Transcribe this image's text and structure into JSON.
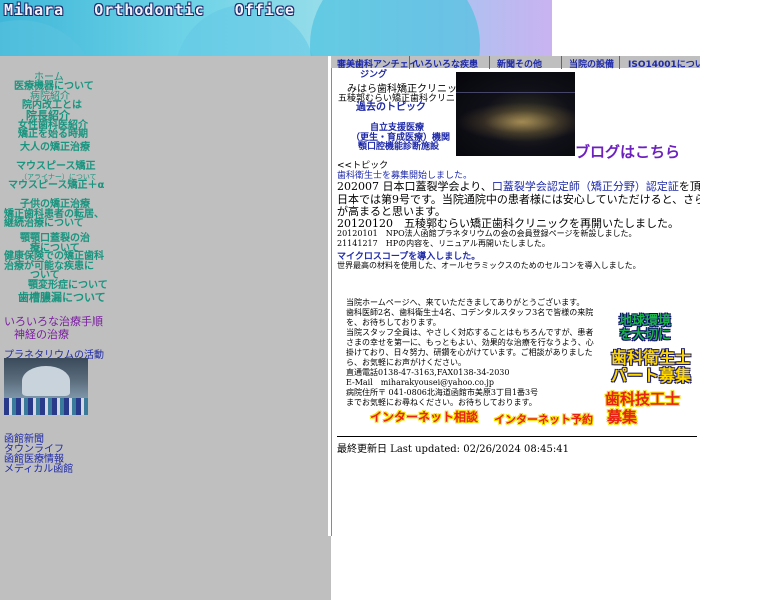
{
  "header": {
    "title": "Mihara   Orthodontic   Office"
  },
  "leftnav": {
    "home": "ホーム",
    "equipment": "医療機器について",
    "clinic_intro": "病院紹介",
    "interior": "院内改工とは",
    "director": "院長紹介",
    "female_dentist": "女性歯科医紹介",
    "start_time": "矯正を始る時期",
    "adult": "大人の矯正治療",
    "mouthpiece": "マウスピース矯正",
    "aligner_note": "（アライナー）について",
    "mouthpiece_plus": "マウスピース矯正＋α",
    "child": "子供の矯正治療",
    "transfer": "矯正歯科患者の転居、",
    "continue": "継続治療について",
    "jaw1": "顎顎口蓋裂の治",
    "jaw2": "療について",
    "insurance1": "健康保険での矯正歯科",
    "insurance2": "治療が可能な疾患に",
    "insurance3": "ついて",
    "deformity": "顎変形症について",
    "caries": "歯槽膿漏について",
    "various": "いろいろな治療手順",
    "nerve": "神経の治療",
    "planetarium": "プラネタリウムの活動",
    "hakodate_news": "函館新聞",
    "town_life": "タウンライフ",
    "hakodate_medical": "函館医療情報",
    "medical_hakodate": "メディカル函館"
  },
  "topnav": {
    "item1": "審美歯科アンチェイ",
    "item1b": "ジング",
    "item2": "いろいろな疾患",
    "item3": "新聞その他",
    "item4": "当院の設備",
    "item5": "ISO14001について"
  },
  "main": {
    "clinic1": "みはら歯科矯正クリニック",
    "clinic2": "五稜郭むらい矯正歯科クリニッ",
    "past_topics": "過去のトピック",
    "support1": "自立支援医療",
    "support2": "（更生・育成医療）機関",
    "support3": "顎口腔機能診断施設",
    "blog": "ブログはこちら",
    "topic_head": "<<トピック",
    "recruit": "歯科衛生士を募集開始しました。",
    "news1_date": "202007 日本口蓋裂学会より、",
    "news1_link": "口蓋裂学会認定師（矯正分野）認定証",
    "news1_tail": "を頂きました。",
    "news1_l2": "日本では第9号です。当院通院中の患者様には安心していただけると、さらに質",
    "news1_l3": "が高まると思います。",
    "news2": "20120120　五稜郭むらい矯正歯科クリニックを再開いたしました。",
    "news3": "20120101　NPO法人函館プラネタリウムの会の会員登録ページを新設しました。",
    "news4": "21141217　HPの内容を、リニュアル再開いたしました。",
    "micro": "マイクロスコープを導入しました。",
    "micro_desc": "世界最高の材料を使用した、オールセラミックスのためのセルコンを導入しました。",
    "greet1": "当院ホームページへ、来ていただきましてありがとうございます。",
    "greet2": "歯科医師2名、歯科衛生士4名、コデンタルスタッフ3名で皆様の来院",
    "greet3": "を、お待ちしております。",
    "greet4": "当院スタッフ全員は、やさしく対応することはもちろんですが、患者",
    "greet5": "さまの幸せを第一に、もっともよい、効果的な治療を行なうよう、心",
    "greet6": "掛けており、日々努力、研鑽を心がけています。ご相談がありました",
    "greet7": "ら、お気軽にお声がけください。",
    "phone": "直通電話0138-47-3163,FAX0138-34-2030",
    "email": "E-Mail　miharakyousei@yahoo.co.jp",
    "address": "病院住所〒 041-0806北海道函館市美原3丁目1番3号",
    "closing": "までお気軽にお尋ねください。お待ちしております。",
    "net_consult": "インターネット相談",
    "net_reserve": "インターネット予約",
    "updated": "最終更新日 Last updated: 02/26/2024 08:45:41"
  },
  "right": {
    "earth1": "地球環境",
    "earth2": "を大切に",
    "hygienist1": "歯科衛生士",
    "hygienist2": "パート募集",
    "technician1": "歯科技工士",
    "technician2": "募集"
  }
}
